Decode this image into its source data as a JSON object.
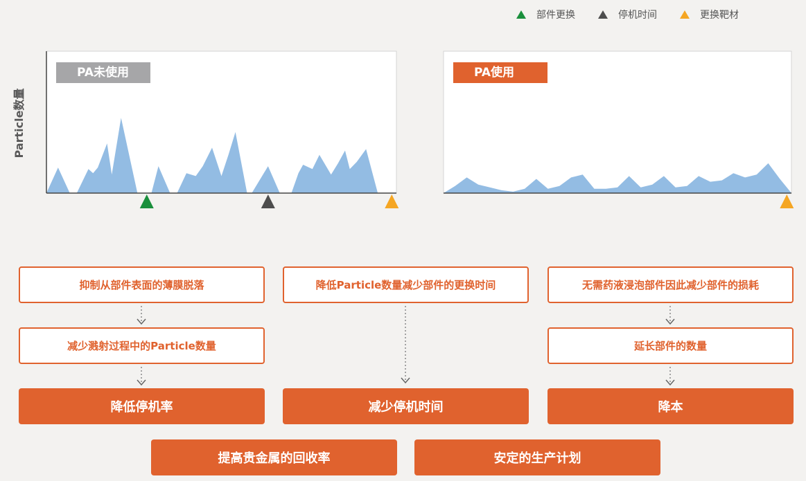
{
  "legend": [
    {
      "label": "部件更换",
      "color": "#1a8f3c"
    },
    {
      "label": "停机时间",
      "color": "#4d4d4d"
    },
    {
      "label": "更换靶材",
      "color": "#f5a623"
    }
  ],
  "ylabel": "Particle数量",
  "chart_data": [
    {
      "type": "area",
      "panel_title": "PA未使用",
      "ylabel": "Particle数量",
      "fill_color": "#93bce3",
      "tag_color": "#a6a6a8",
      "ylim": [
        0,
        100
      ],
      "x": [
        0,
        5,
        10,
        13,
        18,
        20,
        22,
        26,
        28,
        32,
        39,
        43,
        45,
        48,
        53,
        56,
        60,
        64,
        67,
        71,
        75,
        78,
        81,
        86,
        88,
        95,
        100,
        105,
        108,
        110,
        114,
        117,
        122,
        125,
        128,
        130,
        133,
        137,
        142,
        148,
        149,
        150
      ],
      "values": [
        0,
        18,
        0,
        0,
        17,
        14,
        18,
        35,
        13,
        53,
        0,
        0,
        0,
        19,
        0,
        0,
        14,
        12,
        19,
        32,
        12,
        27,
        43,
        0,
        0,
        19,
        0,
        0,
        14,
        20,
        17,
        27,
        13,
        21,
        30,
        17,
        22,
        31,
        0,
        0,
        0,
        0
      ],
      "events": [
        {
          "x": 43,
          "type": "部件更换",
          "color": "#1a8f3c"
        },
        {
          "x": 95,
          "type": "停机时间",
          "color": "#4d4d4d"
        },
        {
          "x": 148,
          "type": "更换靶材",
          "color": "#f5a623"
        }
      ]
    },
    {
      "type": "area",
      "panel_title": "PA使用",
      "ylabel": "Particle数量",
      "fill_color": "#93bce3",
      "tag_color": "#e0622e",
      "ylim": [
        0,
        100
      ],
      "x": [
        0,
        5,
        10,
        15,
        20,
        25,
        30,
        35,
        40,
        45,
        50,
        55,
        60,
        65,
        70,
        75,
        80,
        85,
        90,
        95,
        100,
        105,
        110,
        115,
        120,
        125,
        130,
        135,
        140,
        145,
        150
      ],
      "values": [
        0,
        5,
        11,
        6,
        4,
        2,
        1,
        3,
        10,
        3,
        5,
        11,
        13,
        3,
        3,
        4,
        12,
        4,
        6,
        12,
        4,
        5,
        12,
        8,
        9,
        14,
        11,
        13,
        21,
        10,
        0
      ],
      "events": [
        {
          "x": 148,
          "type": "更换靶材",
          "color": "#f5a623"
        }
      ]
    }
  ],
  "flow": {
    "col1": {
      "step1": "抑制从部件表面的薄膜脱落",
      "step2": "减少溅射过程中的Particle数量",
      "result": "降低停机率"
    },
    "col2": {
      "step1": "降低Particle数量减少部件的更换时间",
      "result": "减少停机时间"
    },
    "col3": {
      "step1": "无需药液浸泡部件因此减少部件的损耗",
      "step2": "延长部件的数量",
      "result": "降本"
    },
    "bottom": [
      "提高贵金属的回收率",
      "安定的生产计划"
    ]
  },
  "colors": {
    "accent": "#e0622e",
    "area": "#93bce3",
    "background": "#f3f2f0"
  }
}
